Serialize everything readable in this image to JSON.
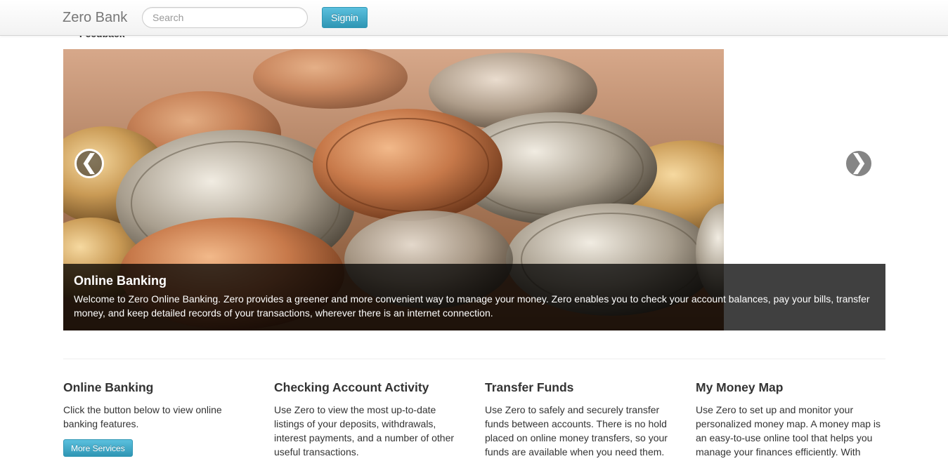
{
  "header": {
    "brand": "Zero Bank",
    "search_placeholder": "Search",
    "signin_label": "Signin"
  },
  "nav": {
    "partial_item": "Feedback"
  },
  "carousel": {
    "prev_glyph": "❮",
    "next_glyph": "❯",
    "caption_title": "Online Banking",
    "caption_text": "Welcome to Zero Online Banking. Zero provides a greener and more convenient way to manage your money. Zero enables you to check your account balances, pay your bills, transfer money, and keep detailed records of your transactions, wherever there is an internet connection."
  },
  "features": [
    {
      "title": "Online Banking",
      "text": "Click the button below to view online banking features.",
      "button": "More Services"
    },
    {
      "title": "Checking Account Activity",
      "text": "Use Zero to view the most up-to-date listings of your deposits, withdrawals, interest payments, and a number of other useful transactions."
    },
    {
      "title": "Transfer Funds",
      "text": "Use Zero to safely and securely transfer funds between accounts. There is no hold placed on online money transfers, so your funds are available when you need them."
    },
    {
      "title": "My Money Map",
      "text": "Use Zero to set up and monitor your personalized money map. A money map is an easy-to-use online tool that helps you manage your finances efficiently. With"
    }
  ],
  "colors": {
    "button_top": "#5bc0de",
    "button_bottom": "#2f96b4",
    "caption_bg": "#000000"
  }
}
